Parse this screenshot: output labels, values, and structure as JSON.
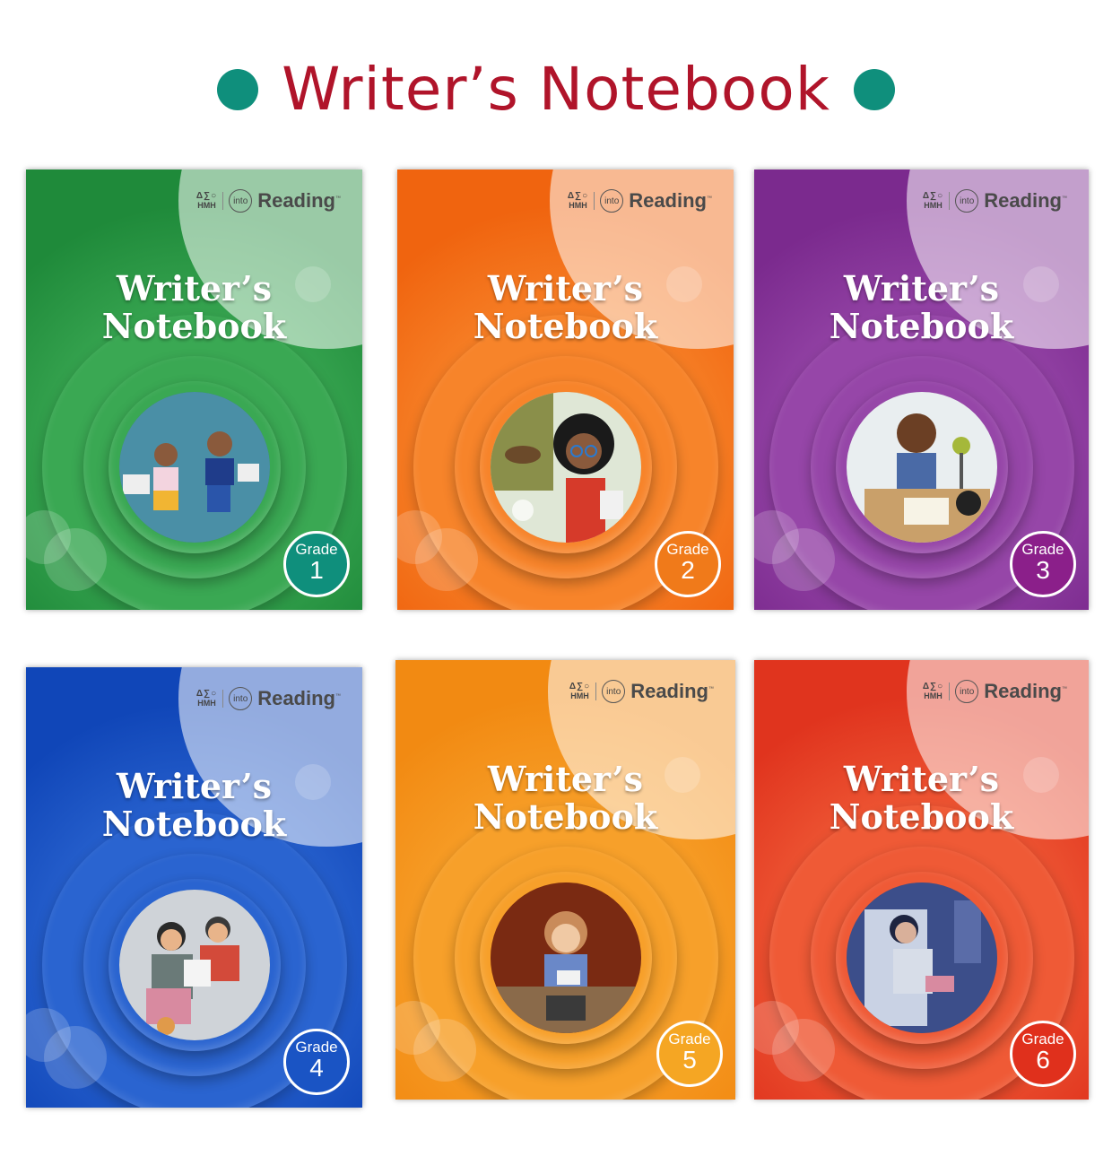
{
  "page": {
    "title": "Writer’s Notebook"
  },
  "colors": {
    "title": "#b0142a",
    "dots": "#0f8f7c"
  },
  "brand": {
    "publisher": "HMH",
    "product_prefix": "into",
    "product_name": "Reading",
    "trademark": "™"
  },
  "covers": [
    {
      "title_line1": "Writer’s",
      "title_line2": "Notebook",
      "grade_label": "Grade",
      "grade": "1",
      "theme": "green",
      "colors": {
        "dark": "#1f8a3a",
        "mid": "#3aa853",
        "light": "#7cc77a",
        "badge": "#0f8f7c"
      },
      "illustration": "two-children-running-icon"
    },
    {
      "title_line1": "Writer’s",
      "title_line2": "Notebook",
      "grade_label": "Grade",
      "grade": "2",
      "theme": "orange",
      "colors": {
        "dark": "#f0640f",
        "mid": "#f7842a",
        "light": "#ffb06a",
        "badge": "#f07a1a"
      },
      "illustration": "girl-with-glasses-icon"
    },
    {
      "title_line1": "Writer’s",
      "title_line2": "Notebook",
      "grade_label": "Grade",
      "grade": "3",
      "theme": "purple",
      "colors": {
        "dark": "#7b2a8e",
        "mid": "#9646a8",
        "light": "#c08ad0",
        "badge": "#8b1f8a"
      },
      "illustration": "boy-writing-with-cat-icon"
    },
    {
      "title_line1": "Writer’s",
      "title_line2": "Notebook",
      "grade_label": "Grade",
      "grade": "4",
      "theme": "blue",
      "colors": {
        "dark": "#1046b8",
        "mid": "#2a64d0",
        "light": "#79a4ea",
        "badge": "#1a54c4"
      },
      "illustration": "family-reading-icon"
    },
    {
      "title_line1": "Writer’s",
      "title_line2": "Notebook",
      "grade_label": "Grade",
      "grade": "5",
      "theme": "amber",
      "colors": {
        "dark": "#f28a12",
        "mid": "#f7a02a",
        "light": "#ffc56a",
        "badge": "#f5a623"
      },
      "illustration": "girl-at-desk-icon"
    },
    {
      "title_line1": "Writer’s",
      "title_line2": "Notebook",
      "grade_label": "Grade",
      "grade": "6",
      "theme": "red",
      "colors": {
        "dark": "#e0341e",
        "mid": "#ef5a36",
        "light": "#ff9a78",
        "badge": "#e0301c"
      },
      "illustration": "teen-reading-on-train-icon"
    }
  ]
}
